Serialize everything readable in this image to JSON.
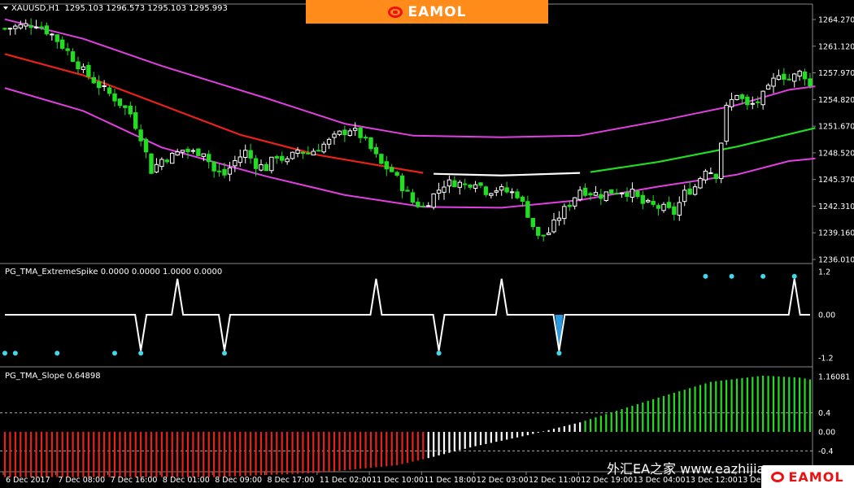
{
  "window": {
    "symbol_title": "XAUUSD,H1",
    "ohlc": "1295.103 1296.573 1295.103 1295.993",
    "logo_text": "EAMOL",
    "watermark": "外汇EA之家 www.eazhijia.com"
  },
  "colors": {
    "background": "#000000",
    "bull": "#ffffff",
    "bear": "#22dd22",
    "envelope": "#e040e0",
    "tma_down": "#e8221a",
    "tma_flat": "#ffffff",
    "tma_up": "#22dd22",
    "spike_line": "#ffffff",
    "spike_dot": "#3fd8e8",
    "spike_special": "#2a9ae0",
    "slope_down": "#e8221a",
    "slope_flat": "#ffffff",
    "slope_up": "#22dd22",
    "separator": "#888888"
  },
  "chart_data": [
    {
      "type": "candlestick",
      "title": "XAUUSD,H1",
      "ylim": [
        1236.01,
        1264.27
      ],
      "yticks": [
        "1264.270",
        "1261.120",
        "1257.970",
        "1254.820",
        "1251.670",
        "1248.520",
        "1245.370",
        "1242.310",
        "1239.160",
        "1236.010"
      ],
      "xticks": [
        "6 Dec 2017",
        "7 Dec 08:00",
        "7 Dec 16:00",
        "8 Dec 01:00",
        "8 Dec 09:00",
        "8 Dec 17:00",
        "11 Dec 02:00",
        "11 Dec 10:00",
        "11 Dec 18:00",
        "12 Dec 03:00",
        "12 Dec 11:00",
        "12 Dec 19:00",
        "13 Dec 04:00",
        "13 Dec 12:00",
        "13 Dec 20:00"
      ],
      "close_path": [
        [
          0,
          1263.2
        ],
        [
          6,
          1263.8
        ],
        [
          9,
          1262.5
        ],
        [
          12,
          1260.5
        ],
        [
          15,
          1258.2
        ],
        [
          18,
          1256.5
        ],
        [
          21,
          1255.0
        ],
        [
          24,
          1253.2
        ],
        [
          26,
          1250.5
        ],
        [
          28,
          1246.5
        ],
        [
          30,
          1247.8
        ],
        [
          32,
          1248.2
        ],
        [
          34,
          1248.9
        ],
        [
          36,
          1248.6
        ],
        [
          38,
          1248.8
        ],
        [
          40,
          1246.4
        ],
        [
          42,
          1246.0
        ],
        [
          44,
          1247.6
        ],
        [
          46,
          1248.7
        ],
        [
          48,
          1247.2
        ],
        [
          50,
          1246.8
        ],
        [
          52,
          1248.3
        ],
        [
          54,
          1247.5
        ],
        [
          56,
          1248.9
        ],
        [
          58,
          1248.5
        ],
        [
          60,
          1249.2
        ],
        [
          62,
          1249.9
        ],
        [
          64,
          1250.8
        ],
        [
          66,
          1251.4
        ],
        [
          68,
          1250.6
        ],
        [
          70,
          1249.0
        ],
        [
          72,
          1247.2
        ],
        [
          74,
          1246.4
        ],
        [
          76,
          1244.6
        ],
        [
          78,
          1242.8
        ],
        [
          80,
          1242.2
        ],
        [
          82,
          1243.6
        ],
        [
          84,
          1244.9
        ],
        [
          86,
          1245.1
        ],
        [
          88,
          1244.8
        ],
        [
          90,
          1245.3
        ],
        [
          92,
          1244.1
        ],
        [
          94,
          1244.3
        ],
        [
          96,
          1244.0
        ],
        [
          98,
          1243.7
        ],
        [
          100,
          1241.4
        ],
        [
          102,
          1238.6
        ],
        [
          104,
          1239.2
        ],
        [
          106,
          1241.1
        ],
        [
          108,
          1242.6
        ],
        [
          110,
          1244.3
        ],
        [
          112,
          1243.9
        ],
        [
          114,
          1243.6
        ],
        [
          116,
          1244.0
        ],
        [
          118,
          1244.1
        ],
        [
          120,
          1243.8
        ],
        [
          122,
          1242.6
        ],
        [
          124,
          1242.3
        ],
        [
          126,
          1242.0
        ],
        [
          128,
          1241.5
        ],
        [
          130,
          1243.8
        ],
        [
          132,
          1244.6
        ],
        [
          134,
          1246.8
        ],
        [
          136,
          1246.0
        ],
        [
          138,
          1253.8
        ],
        [
          140,
          1255.6
        ],
        [
          142,
          1254.0
        ],
        [
          144,
          1254.6
        ],
        [
          146,
          1256.0
        ],
        [
          148,
          1258.1
        ],
        [
          150,
          1257.2
        ],
        [
          152,
          1258.0
        ],
        [
          153,
          1257.7
        ],
        [
          154,
          1256.4
        ]
      ],
      "envelope_upper": [
        [
          0,
          1264.3
        ],
        [
          15,
          1262.0
        ],
        [
          30,
          1258.8
        ],
        [
          50,
          1255.0
        ],
        [
          65,
          1252.0
        ],
        [
          78,
          1250.6
        ],
        [
          95,
          1250.4
        ],
        [
          110,
          1250.6
        ],
        [
          125,
          1252.3
        ],
        [
          140,
          1254.2
        ],
        [
          150,
          1256.0
        ],
        [
          155,
          1256.4
        ]
      ],
      "envelope_lower": [
        [
          0,
          1256.2
        ],
        [
          15,
          1253.5
        ],
        [
          30,
          1249.2
        ],
        [
          50,
          1245.8
        ],
        [
          65,
          1243.6
        ],
        [
          80,
          1242.2
        ],
        [
          95,
          1242.1
        ],
        [
          110,
          1243.0
        ],
        [
          125,
          1244.6
        ],
        [
          140,
          1246.0
        ],
        [
          150,
          1247.6
        ],
        [
          155,
          1247.9
        ]
      ],
      "tma_segments": [
        {
          "trend": "down",
          "points": [
            [
              0,
              1260.2
            ],
            [
              15,
              1257.7
            ],
            [
              30,
              1254.2
            ],
            [
              45,
              1250.7
            ],
            [
              60,
              1248.3
            ],
            [
              80,
              1246.2
            ]
          ]
        },
        {
          "trend": "flat",
          "points": [
            [
              82,
              1246.1
            ],
            [
              95,
              1245.9
            ],
            [
              110,
              1246.2
            ]
          ]
        },
        {
          "trend": "up",
          "points": [
            [
              112,
              1246.3
            ],
            [
              125,
              1247.5
            ],
            [
              140,
              1249.3
            ],
            [
              155,
              1251.5
            ]
          ]
        }
      ]
    },
    {
      "type": "line",
      "title": "PG_TMA_ExtremeSpike 0.0000 0.0000 1.0000 0.0000",
      "ylim": [
        -1.2,
        1.2
      ],
      "yticks": [
        "1.2",
        "0.00",
        "-1.2"
      ],
      "spikes": [
        {
          "x": 26,
          "value": -1
        },
        {
          "x": 33,
          "value": 1
        },
        {
          "x": 42,
          "value": -1
        },
        {
          "x": 71,
          "value": 1
        },
        {
          "x": 83,
          "value": -1
        },
        {
          "x": 95,
          "value": 1
        },
        {
          "x": 106,
          "value": -1,
          "highlight": true
        },
        {
          "x": 151,
          "value": 1
        }
      ],
      "dots_low": [
        0,
        2,
        10,
        21,
        26,
        42,
        83,
        106
      ],
      "dots_high": [
        134,
        139,
        145,
        151
      ]
    },
    {
      "type": "bar",
      "title": "PG_TMA_Slope 0.64898",
      "ylim": [
        -0.7,
        1.16081
      ],
      "yticks": [
        "1.16081",
        "0.4",
        "0.00",
        "-0.4"
      ],
      "levels": [
        0.4,
        -0.4
      ],
      "slope_path": [
        [
          0,
          -0.95
        ],
        [
          40,
          -0.95
        ],
        [
          60,
          -0.86
        ],
        [
          75,
          -0.7
        ],
        [
          81,
          -0.55
        ],
        [
          90,
          -0.3
        ],
        [
          100,
          -0.07
        ],
        [
          110,
          0.2
        ],
        [
          125,
          0.72
        ],
        [
          135,
          1.05
        ],
        [
          145,
          1.18
        ],
        [
          152,
          1.14
        ],
        [
          154,
          1.1
        ]
      ],
      "trend_breaks": {
        "down_until": 81,
        "flat_until": 111
      }
    }
  ]
}
